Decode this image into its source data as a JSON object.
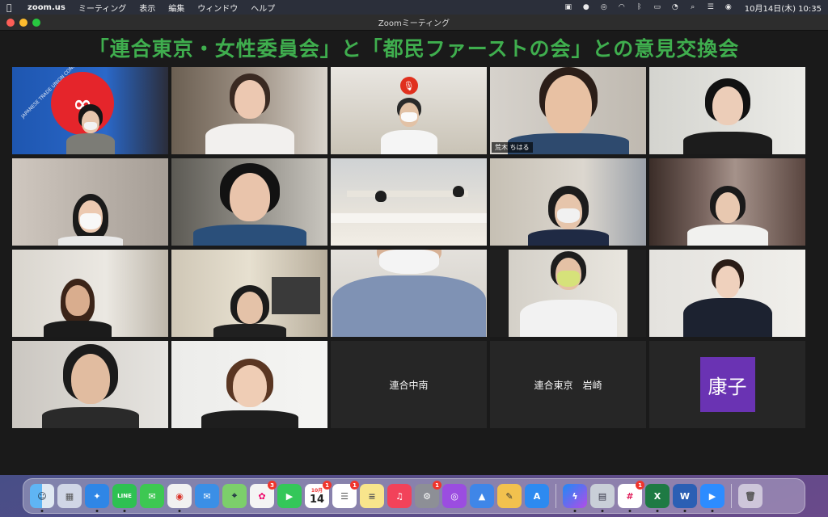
{
  "menubar": {
    "app_name": "zoom.us",
    "items": [
      "ミーティング",
      "表示",
      "編集",
      "ウィンドウ",
      "ヘルプ"
    ],
    "clock": "10月14日(木)  10:35"
  },
  "window": {
    "title": "Zoomミーティング"
  },
  "banner": {
    "text": "「連合東京・女性委員会」と「都民ファーストの会」との意見交換会",
    "color": "#3fae4e"
  },
  "tiles": {
    "active_name": "荒木 ちはる",
    "text_tile_1": "連合中南",
    "text_tile_2": "連合東京　岩崎",
    "avatar_name": "康子",
    "avatar_color": "#6a33b3"
  },
  "dock": {
    "calendar_day": "14",
    "calendar_month": "10月",
    "badges": {
      "photos": "3",
      "calendar": "1",
      "reminders": "1",
      "system_prefs": "1",
      "slack": "1"
    }
  }
}
